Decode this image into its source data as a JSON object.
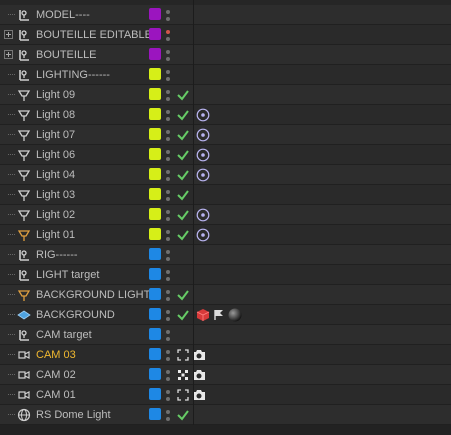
{
  "colors": {
    "purple": "#9b15bf",
    "yellow": "#d6ef18",
    "blue": "#1e88e5",
    "active_text": "#f0b830",
    "check": "#66cc66"
  },
  "rows": [
    {
      "name": "MODEL----",
      "icon": "null-icon",
      "layer": "purple",
      "dot": "grey",
      "expander": false,
      "active": false,
      "tags": []
    },
    {
      "name": "BOUTEILLE EDITABLE",
      "icon": "null-icon",
      "layer": "purple",
      "dot": "red",
      "expander": true,
      "active": false,
      "tags": []
    },
    {
      "name": "BOUTEILLE",
      "icon": "null-icon",
      "layer": "purple",
      "dot": "grey",
      "expander": true,
      "active": false,
      "tags": []
    },
    {
      "name": "LIGHTING------",
      "icon": "null-icon",
      "layer": "yellow",
      "dot": "grey",
      "expander": false,
      "active": false,
      "tags": []
    },
    {
      "name": "Light 09",
      "icon": "light-icon",
      "layer": "yellow",
      "dot": "grey",
      "expander": false,
      "active": false,
      "tags": [
        "check"
      ]
    },
    {
      "name": "Light 08",
      "icon": "light-icon",
      "layer": "yellow",
      "dot": "grey",
      "expander": false,
      "active": false,
      "tags": [
        "check",
        "target"
      ]
    },
    {
      "name": "Light 07",
      "icon": "light-icon",
      "layer": "yellow",
      "dot": "grey",
      "expander": false,
      "active": false,
      "tags": [
        "check",
        "target"
      ]
    },
    {
      "name": "Light 06",
      "icon": "light-icon",
      "layer": "yellow",
      "dot": "grey",
      "expander": false,
      "active": false,
      "tags": [
        "check",
        "target"
      ]
    },
    {
      "name": "Light 04",
      "icon": "light-icon",
      "layer": "yellow",
      "dot": "grey",
      "expander": false,
      "active": false,
      "tags": [
        "check",
        "target"
      ]
    },
    {
      "name": "Light 03",
      "icon": "light-icon",
      "layer": "yellow",
      "dot": "grey",
      "expander": false,
      "active": false,
      "tags": [
        "check"
      ]
    },
    {
      "name": "Light 02",
      "icon": "light-icon",
      "layer": "yellow",
      "dot": "grey",
      "expander": false,
      "active": false,
      "tags": [
        "check",
        "target"
      ]
    },
    {
      "name": "Light 01",
      "icon": "light-orange-icon",
      "layer": "yellow",
      "dot": "grey",
      "expander": false,
      "active": false,
      "tags": [
        "check",
        "target"
      ]
    },
    {
      "name": "RIG------",
      "icon": "null-icon",
      "layer": "blue",
      "dot": "grey",
      "expander": false,
      "active": false,
      "tags": []
    },
    {
      "name": "LIGHT target",
      "icon": "null-icon",
      "layer": "blue",
      "dot": "grey",
      "expander": false,
      "active": false,
      "tags": []
    },
    {
      "name": "BACKGROUND LIGHT",
      "icon": "light-orange-icon",
      "layer": "blue",
      "dot": "grey",
      "expander": false,
      "active": false,
      "tags": [
        "check"
      ]
    },
    {
      "name": "BACKGROUND",
      "icon": "background-icon",
      "layer": "blue",
      "dot": "grey",
      "expander": false,
      "active": false,
      "tags": [
        "check",
        "cube",
        "flag",
        "material"
      ]
    },
    {
      "name": "CAM target",
      "icon": "null-icon",
      "layer": "blue",
      "dot": "grey",
      "expander": false,
      "active": false,
      "tags": []
    },
    {
      "name": "CAM 03",
      "icon": "camera-icon",
      "layer": "blue",
      "dot": "grey",
      "expander": false,
      "active": true,
      "tags": [
        "frame",
        "camera"
      ]
    },
    {
      "name": "CAM 02",
      "icon": "camera-icon",
      "layer": "blue",
      "dot": "grey",
      "expander": false,
      "active": false,
      "tags": [
        "checker",
        "camera"
      ]
    },
    {
      "name": "CAM 01",
      "icon": "camera-icon",
      "layer": "blue",
      "dot": "grey",
      "expander": false,
      "active": false,
      "tags": [
        "frame",
        "camera"
      ]
    },
    {
      "name": "RS Dome Light",
      "icon": "dome-icon",
      "layer": "blue",
      "dot": "grey",
      "expander": false,
      "active": false,
      "tags": [
        "check"
      ]
    }
  ]
}
